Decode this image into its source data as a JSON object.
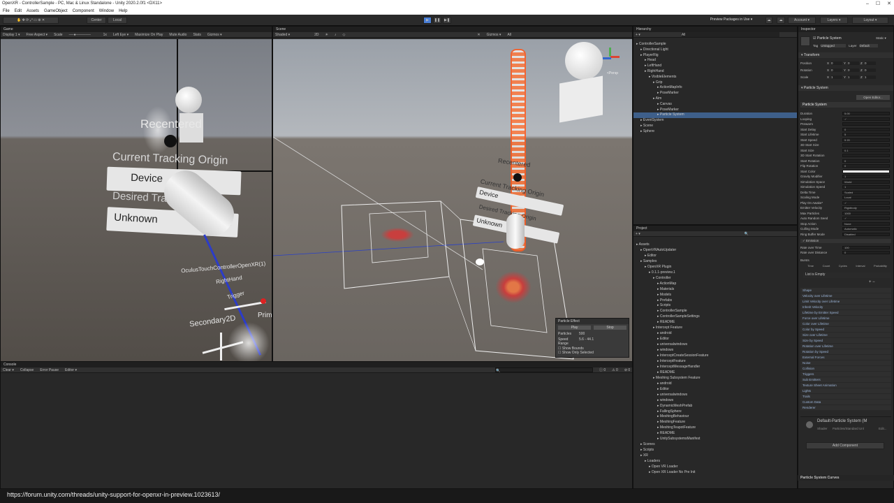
{
  "window": {
    "title": "OpenXR - ControllerSample - PC, Mac & Linux Standalone - Unity 2020.2.0f1 <DX11>",
    "controls": [
      "–",
      "☐",
      "✕"
    ]
  },
  "menu": [
    "File",
    "Edit",
    "Assets",
    "GameObject",
    "Component",
    "Window",
    "Help"
  ],
  "toolbar": {
    "pivot": "Center",
    "space": "Local",
    "packages": "Preview Packages in Use ▾",
    "account": "Account ▾",
    "layers": "Layers ▾",
    "layout": "Layout ▾"
  },
  "game": {
    "tab": "Game",
    "controls": [
      "Display 1 ▾",
      "Free Aspect ▾",
      "Scale",
      "1x",
      "Left Eye ▾",
      "Maximize On Play",
      "Mute Audio",
      "Stats",
      "Gizmos ▾"
    ],
    "vr": {
      "recentered": "Recentered",
      "origin_title": "Current Tracking Origin",
      "device": "Device",
      "desired": "Desired Tracking Origin",
      "unknown": "Unknown",
      "controller": "OculusTouchControllerOpenXR(1)",
      "hand": "RightHand",
      "trigger": "Trigger",
      "secondary": "Secondary2D",
      "primary": "Prim"
    }
  },
  "scene": {
    "tab": "Scene",
    "mode": "Shaded ▾",
    "dim": "2D",
    "gizmos": "Gizmos ▾",
    "search": "All",
    "persp": "<Persp",
    "vr": {
      "recentered": "Recentered",
      "origin": "Current Tracking Origin",
      "device": "Device",
      "desired": "Desired Tracking Origin",
      "unknown": "Unknown"
    },
    "particle": {
      "title": "Particle Effect",
      "play": "Play",
      "stop": "Stop",
      "particles_label": "Particles",
      "particles": "500",
      "speed_label": "Speed Range",
      "speed": "5.6 - 44.1",
      "bounds": "Show Bounds",
      "only_sel": "Show Only Selected"
    }
  },
  "hierarchy": {
    "tab": "Hierarchy",
    "search": "All",
    "items": [
      {
        "t": "ControllerSample",
        "d": 0
      },
      {
        "t": "Directional Light",
        "d": 1
      },
      {
        "t": "PlayerRig",
        "d": 1
      },
      {
        "t": "Head",
        "d": 2
      },
      {
        "t": "LeftHand",
        "d": 2
      },
      {
        "t": "RightHand",
        "d": 2
      },
      {
        "t": "VisibleElements",
        "d": 3
      },
      {
        "t": "Grip",
        "d": 4
      },
      {
        "t": "ActionMapInfo",
        "d": 5
      },
      {
        "t": "PoseMarker",
        "d": 5
      },
      {
        "t": "Aim",
        "d": 4
      },
      {
        "t": "Canvas",
        "d": 5
      },
      {
        "t": "PoseMarker",
        "d": 5
      },
      {
        "t": "Particle System",
        "d": 5
      },
      {
        "t": "EventSystem",
        "d": 1
      },
      {
        "t": "Scene",
        "d": 1
      },
      {
        "t": "Sphere",
        "d": 1
      }
    ]
  },
  "project": {
    "tab": "Project",
    "items": [
      {
        "t": "Assets",
        "d": 0
      },
      {
        "t": "OpenVRAutoUpdater",
        "d": 1
      },
      {
        "t": "Editor",
        "d": 2
      },
      {
        "t": "Samples",
        "d": 1
      },
      {
        "t": "OpenXR Plugin",
        "d": 2
      },
      {
        "t": "0.1.1-preview.1",
        "d": 3
      },
      {
        "t": "Controller",
        "d": 4
      },
      {
        "t": "ActionMap",
        "d": 5
      },
      {
        "t": "Materials",
        "d": 5
      },
      {
        "t": "Models",
        "d": 5
      },
      {
        "t": "Prefabs",
        "d": 5
      },
      {
        "t": "Scripts",
        "d": 5
      },
      {
        "t": "ControllerSample",
        "d": 5
      },
      {
        "t": "ControllerSampleSettings",
        "d": 5
      },
      {
        "t": "README",
        "d": 5
      },
      {
        "t": "Intercept Feature",
        "d": 4
      },
      {
        "t": "android",
        "d": 5
      },
      {
        "t": "Editor",
        "d": 5
      },
      {
        "t": "universalwindows",
        "d": 5
      },
      {
        "t": "windows",
        "d": 5
      },
      {
        "t": "InterceptCreateSessionFeature",
        "d": 5
      },
      {
        "t": "InterceptFeature",
        "d": 5
      },
      {
        "t": "InterceptMessageHandler",
        "d": 5
      },
      {
        "t": "README",
        "d": 5
      },
      {
        "t": "Meshing Subsystem Feature",
        "d": 4
      },
      {
        "t": "android",
        "d": 5
      },
      {
        "t": "Editor",
        "d": 5
      },
      {
        "t": "universalwindows",
        "d": 5
      },
      {
        "t": "windows",
        "d": 5
      },
      {
        "t": "DynamicMeshPrefab",
        "d": 5
      },
      {
        "t": "FallingSphere",
        "d": 5
      },
      {
        "t": "MeshingBehaviour",
        "d": 5
      },
      {
        "t": "MeshingFeature",
        "d": 5
      },
      {
        "t": "MeshingTeapotFeature",
        "d": 5
      },
      {
        "t": "README",
        "d": 5
      },
      {
        "t": "UnitySubsystemsManifest",
        "d": 5
      },
      {
        "t": "Scenes",
        "d": 1
      },
      {
        "t": "Scripts",
        "d": 1
      },
      {
        "t": "XR",
        "d": 1
      },
      {
        "t": "Loaders",
        "d": 2
      },
      {
        "t": "Open VR Loader",
        "d": 3
      },
      {
        "t": "Open XR Loader No Pre Init",
        "d": 3
      }
    ]
  },
  "console": {
    "tab": "Console",
    "buttons": [
      "Clear ▾",
      "Collapse",
      "Error Pause",
      "Editor ▾"
    ],
    "counts": [
      "0",
      "0",
      "0"
    ]
  },
  "inspector": {
    "tab": "Inspector",
    "object": "Particle System",
    "static": "Static ▾",
    "tag_label": "Tag",
    "tag": "Untagged",
    "layer_label": "Layer",
    "layer": "Default",
    "transform": {
      "title": "Transform",
      "rows": [
        {
          "l": "Position",
          "x": "0",
          "y": "0",
          "z": "0"
        },
        {
          "l": "Rotation",
          "x": "0",
          "y": "0",
          "z": "0"
        },
        {
          "l": "Scale",
          "x": "1",
          "y": "1",
          "z": "1"
        }
      ]
    },
    "ps_title": "Particle System",
    "open_editor": "Open Editor...",
    "ps_sub": "Particle System",
    "props": [
      {
        "l": "Duration",
        "v": "5.00"
      },
      {
        "l": "Looping",
        "v": "✓"
      },
      {
        "l": "Prewarm",
        "v": ""
      },
      {
        "l": "Start Delay",
        "v": "0"
      },
      {
        "l": "Start Lifetime",
        "v": "5"
      },
      {
        "l": "Start Speed",
        "v": "5        20"
      },
      {
        "l": "3D Start Size",
        "v": ""
      },
      {
        "l": "Start Size",
        "v": "0.1"
      },
      {
        "l": "3D Start Rotation",
        "v": ""
      },
      {
        "l": "Start Rotation",
        "v": "0"
      },
      {
        "l": "Flip Rotation",
        "v": "0"
      },
      {
        "l": "Start Color",
        "v": ""
      },
      {
        "l": "Gravity Modifier",
        "v": "1"
      },
      {
        "l": "Simulation Space",
        "v": "World"
      },
      {
        "l": "Simulation Speed",
        "v": "1"
      },
      {
        "l": "Delta Time",
        "v": "Scaled"
      },
      {
        "l": "Scaling Mode",
        "v": "Local"
      },
      {
        "l": "Play On Awake*",
        "v": "✓"
      },
      {
        "l": "Emitter Velocity",
        "v": "Rigidbody"
      },
      {
        "l": "Max Particles",
        "v": "1000"
      },
      {
        "l": "Auto Random Seed",
        "v": "✓"
      },
      {
        "l": "Stop Action",
        "v": "None"
      },
      {
        "l": "Culling Mode",
        "v": "Automatic"
      },
      {
        "l": "Ring Buffer Mode",
        "v": "Disabled"
      }
    ],
    "emission": {
      "title": "Emission",
      "rate_time": "Rate over Time",
      "rate_time_v": "100",
      "rate_dist": "Rate over Distance",
      "rate_dist_v": "0",
      "bursts": "Bursts",
      "cols": [
        "Time",
        "Count",
        "Cycles",
        "Interval",
        "Probability"
      ],
      "empty": "List is Empty"
    },
    "modules": [
      "Shape",
      "Velocity over Lifetime",
      "Limit Velocity over Lifetime",
      "Inherit Velocity",
      "Lifetime by Emitter Speed",
      "Force over Lifetime",
      "Color over Lifetime",
      "Color by Speed",
      "Size over Lifetime",
      "Size by Speed",
      "Rotation over Lifetime",
      "Rotation by Speed",
      "External Forces",
      "Noise",
      "Collision",
      "Triggers",
      "Sub Emitters",
      "Texture Sheet Animation",
      "Lights",
      "Trails",
      "Custom Data",
      "Renderer"
    ],
    "material": "Default-Particle System (M",
    "shader_label": "Shader",
    "shader": "Particles/Standard Unl",
    "edit": "Edit...",
    "add_component": "Add Component",
    "curves": "Particle System Curves"
  },
  "status_url": "https://forum.unity.com/threads/unity-support-for-openxr-in-preview.1023613/",
  "colors": {
    "accent": "#3e5f8a",
    "selection": "#3e5f8a",
    "particle": "#ff5a1f",
    "play_button": "#4a7fd6"
  }
}
